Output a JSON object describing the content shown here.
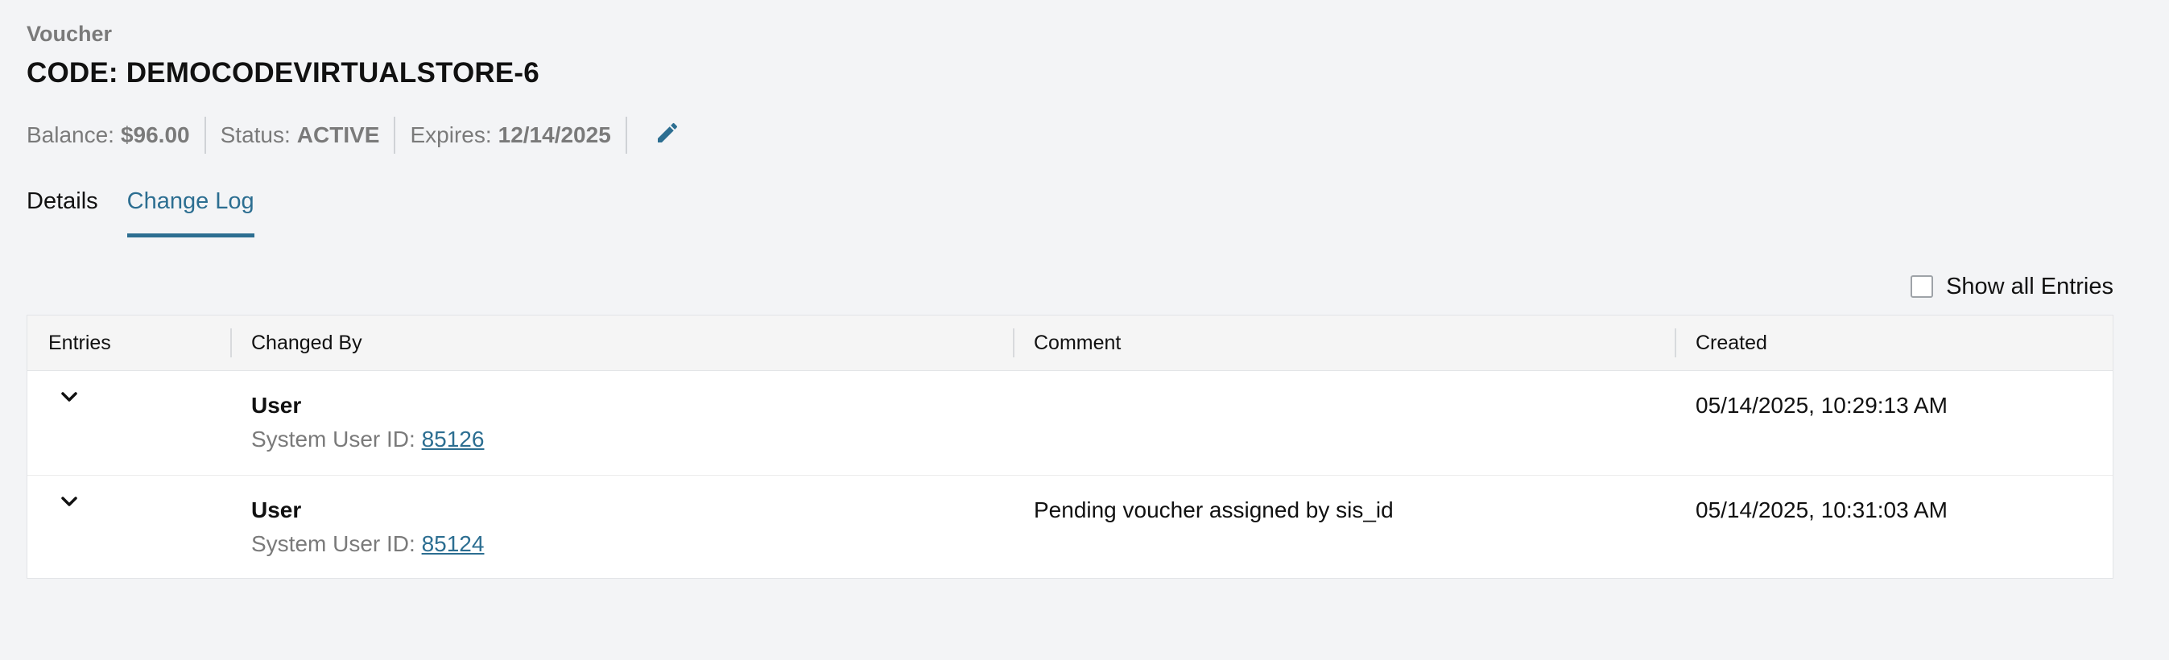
{
  "header": {
    "label": "Voucher",
    "code": "CODE: DEMOCODEVIRTUALSTORE-6"
  },
  "meta": {
    "balance_label": "Balance:",
    "balance_value": "$96.00",
    "status_label": "Status:",
    "status_value": "ACTIVE",
    "expires_label": "Expires:",
    "expires_value": "12/14/2025",
    "edit_icon": "pencil-icon"
  },
  "tabs": [
    {
      "label": "Details",
      "active": false
    },
    {
      "label": "Change Log",
      "active": true
    }
  ],
  "filter": {
    "show_all_label": "Show all Entries",
    "checked": false
  },
  "table": {
    "headers": [
      "Entries",
      "Changed By",
      "Comment",
      "Created"
    ],
    "rows": [
      {
        "user": "User",
        "sub_label": "System User ID:",
        "user_id": "85126",
        "comment": "",
        "created": "05/14/2025, 10:29:13 AM"
      },
      {
        "user": "User",
        "sub_label": "System User ID:",
        "user_id": "85124",
        "comment": "Pending voucher assigned by sis_id",
        "created": "05/14/2025, 10:31:03 AM"
      }
    ]
  },
  "colors": {
    "accent": "#2c6e91",
    "muted": "#7a7a7a",
    "background": "#f3f4f6"
  }
}
